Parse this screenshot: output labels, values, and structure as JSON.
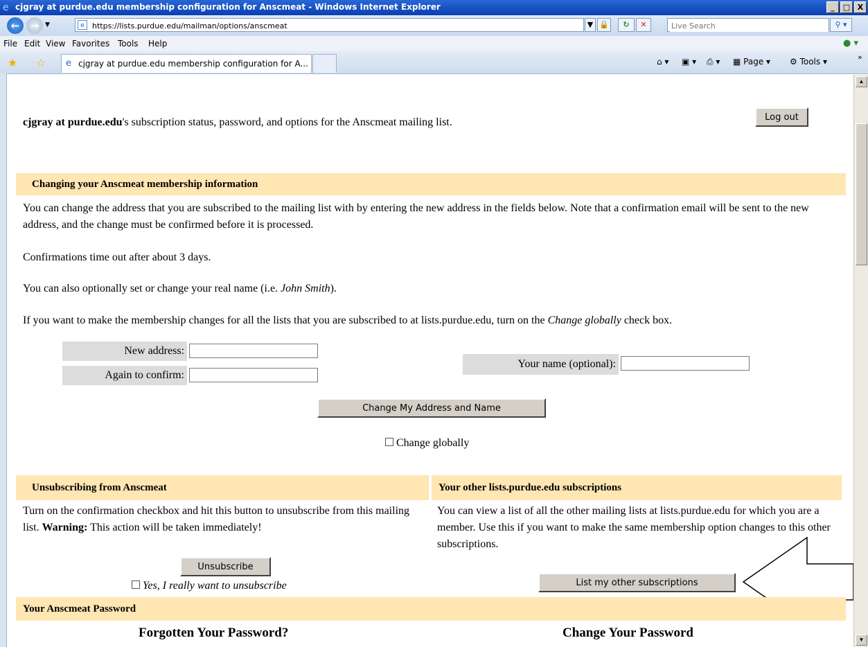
{
  "window": {
    "title": "cjgray at purdue.edu membership configuration for Anscmeat - Windows Internet Explorer",
    "buttons": [
      "_",
      "□",
      "X"
    ]
  },
  "address_bar": {
    "url": "https://lists.purdue.edu/mailman/options/anscmeat",
    "search_placeholder": "Live Search"
  },
  "menu": [
    "File",
    "Edit",
    "View",
    "Favorites",
    "Tools",
    "Help"
  ],
  "tab": {
    "title": "cjgray at purdue.edu membership configuration for A..."
  },
  "command_bar": {
    "page": "Page",
    "tools": "Tools"
  },
  "page": {
    "intro_user": "cjgray at purdue.edu",
    "intro_rest": "'s subscription status, password, and options for the Anscmeat mailing list.",
    "logout": "Log out",
    "change_section": {
      "header": "Changing your Anscmeat membership information",
      "para1": "You can change the address that you are subscribed to the mailing list with by entering the new address in the fields below. Note that a confirmation email will be sent to the new address, and the change must be confirmed before it is processed.",
      "para2": "Confirmations time out after about 3 days.",
      "para3_prefix": "You can also optionally set or change your real name (i.e. ",
      "para3_example": "John Smith",
      "para3_suffix": ").",
      "para4_prefix": "If you want to make the membership changes for all the lists that you are subscribed to at lists.purdue.edu, turn on the ",
      "para4_em": "Change globally",
      "para4_suffix": " check box.",
      "new_address_label": "New address:",
      "confirm_label": "Again to confirm:",
      "name_label": "Your name (optional):",
      "submit": "Change My Address and Name",
      "change_globally": "Change globally"
    },
    "unsubscribe": {
      "header": "Unsubscribing from Anscmeat",
      "text_prefix": "Turn on the confirmation checkbox and hit this button to unsubscribe from this mailing list. ",
      "warning": "Warning:",
      "text_suffix": " This action will be taken immediately!",
      "button": "Unsubscribe",
      "confirm": "Yes, I really want to unsubscribe"
    },
    "other_subs": {
      "header": "Your other lists.purdue.edu subscriptions",
      "text": "You can view a list of all the other mailing lists at lists.purdue.edu for which you are a member. Use this if you want to make the same membership option changes to this other subscriptions.",
      "button": "List my other subscriptions"
    },
    "password": {
      "header": "Your Anscmeat Password",
      "forgotten": "Forgotten Your Password?",
      "change": "Change Your Password"
    }
  }
}
